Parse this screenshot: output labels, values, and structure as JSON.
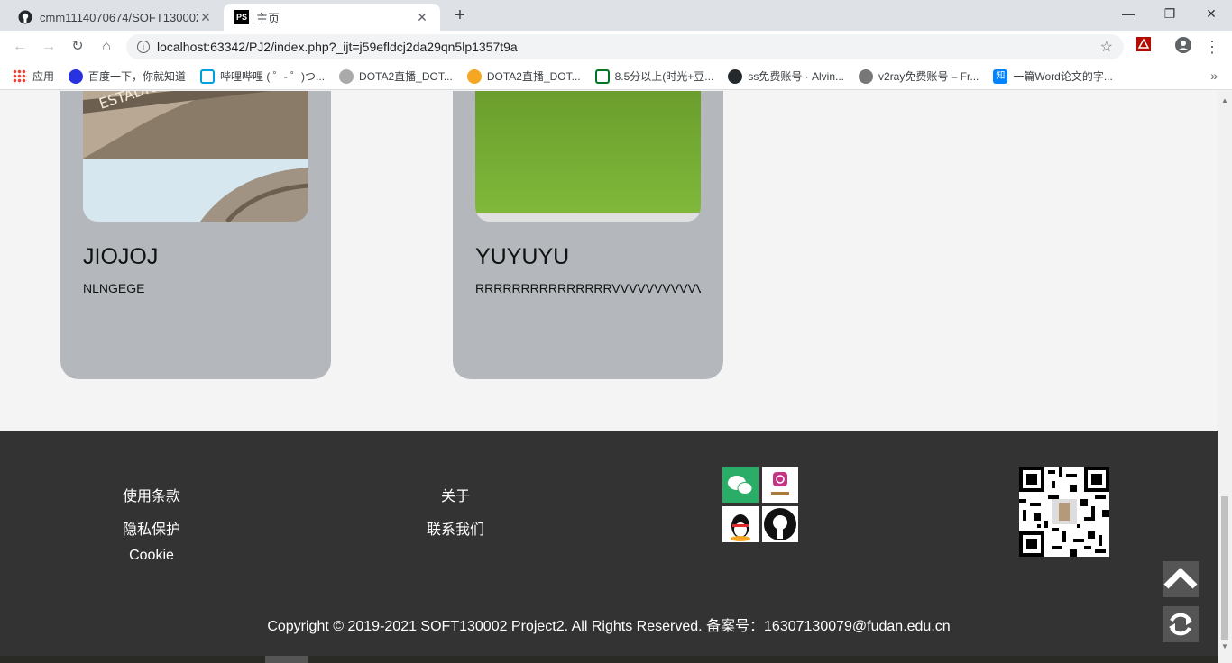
{
  "browser": {
    "tabs": [
      {
        "title": "cmm1114070674/SOFT130002",
        "active": false
      },
      {
        "title": "主页",
        "active": true
      }
    ],
    "url": "localhost:63342/PJ2/index.php?_ijt=j59efldcj2da29qn5lp1357t9a",
    "bookmarks": [
      {
        "label": "应用",
        "icon": "apps-grid-icon"
      },
      {
        "label": "百度一下，你就知道",
        "icon": "baidu-icon"
      },
      {
        "label": "哔哩哔哩 ( ゜- ゜)つ...",
        "icon": "bilibili-icon"
      },
      {
        "label": "DOTA2直播_DOT...",
        "icon": "dota-icon"
      },
      {
        "label": "DOTA2直播_DOT...",
        "icon": "douyu-icon"
      },
      {
        "label": "8.5分以上(时光+豆...",
        "icon": "douban-icon"
      },
      {
        "label": "ss免费账号 · Alvin...",
        "icon": "github-icon"
      },
      {
        "label": "v2ray免费账号 – Fr...",
        "icon": "globe-icon"
      },
      {
        "label": "一篇Word论文的字...",
        "icon": "zhihu-icon"
      }
    ]
  },
  "cards": [
    {
      "title": "JIOJOJ",
      "description": "NLNGEGE"
    },
    {
      "title": "YUYUYU",
      "description": "RRRRRRRRRRRRRRRVVVVVVVVVVVVVVVV"
    }
  ],
  "footer": {
    "links_col1": [
      "使用条款",
      "隐私保护",
      "Cookie"
    ],
    "links_col2": [
      "关于",
      "联系我们"
    ],
    "social": [
      "wechat-icon",
      "instagram-icon",
      "qq-icon",
      "github-icon"
    ],
    "qr": "qr-code",
    "copyright": "Copyright © 2019-2021 SOFT130002 Project2. All Rights Reserved. 备案号：16307130079@fudan.edu.cn"
  },
  "colors": {
    "footer_bg": "#333333",
    "card_bg": "#b4b8bc",
    "page_bg": "#f4f4f4"
  }
}
